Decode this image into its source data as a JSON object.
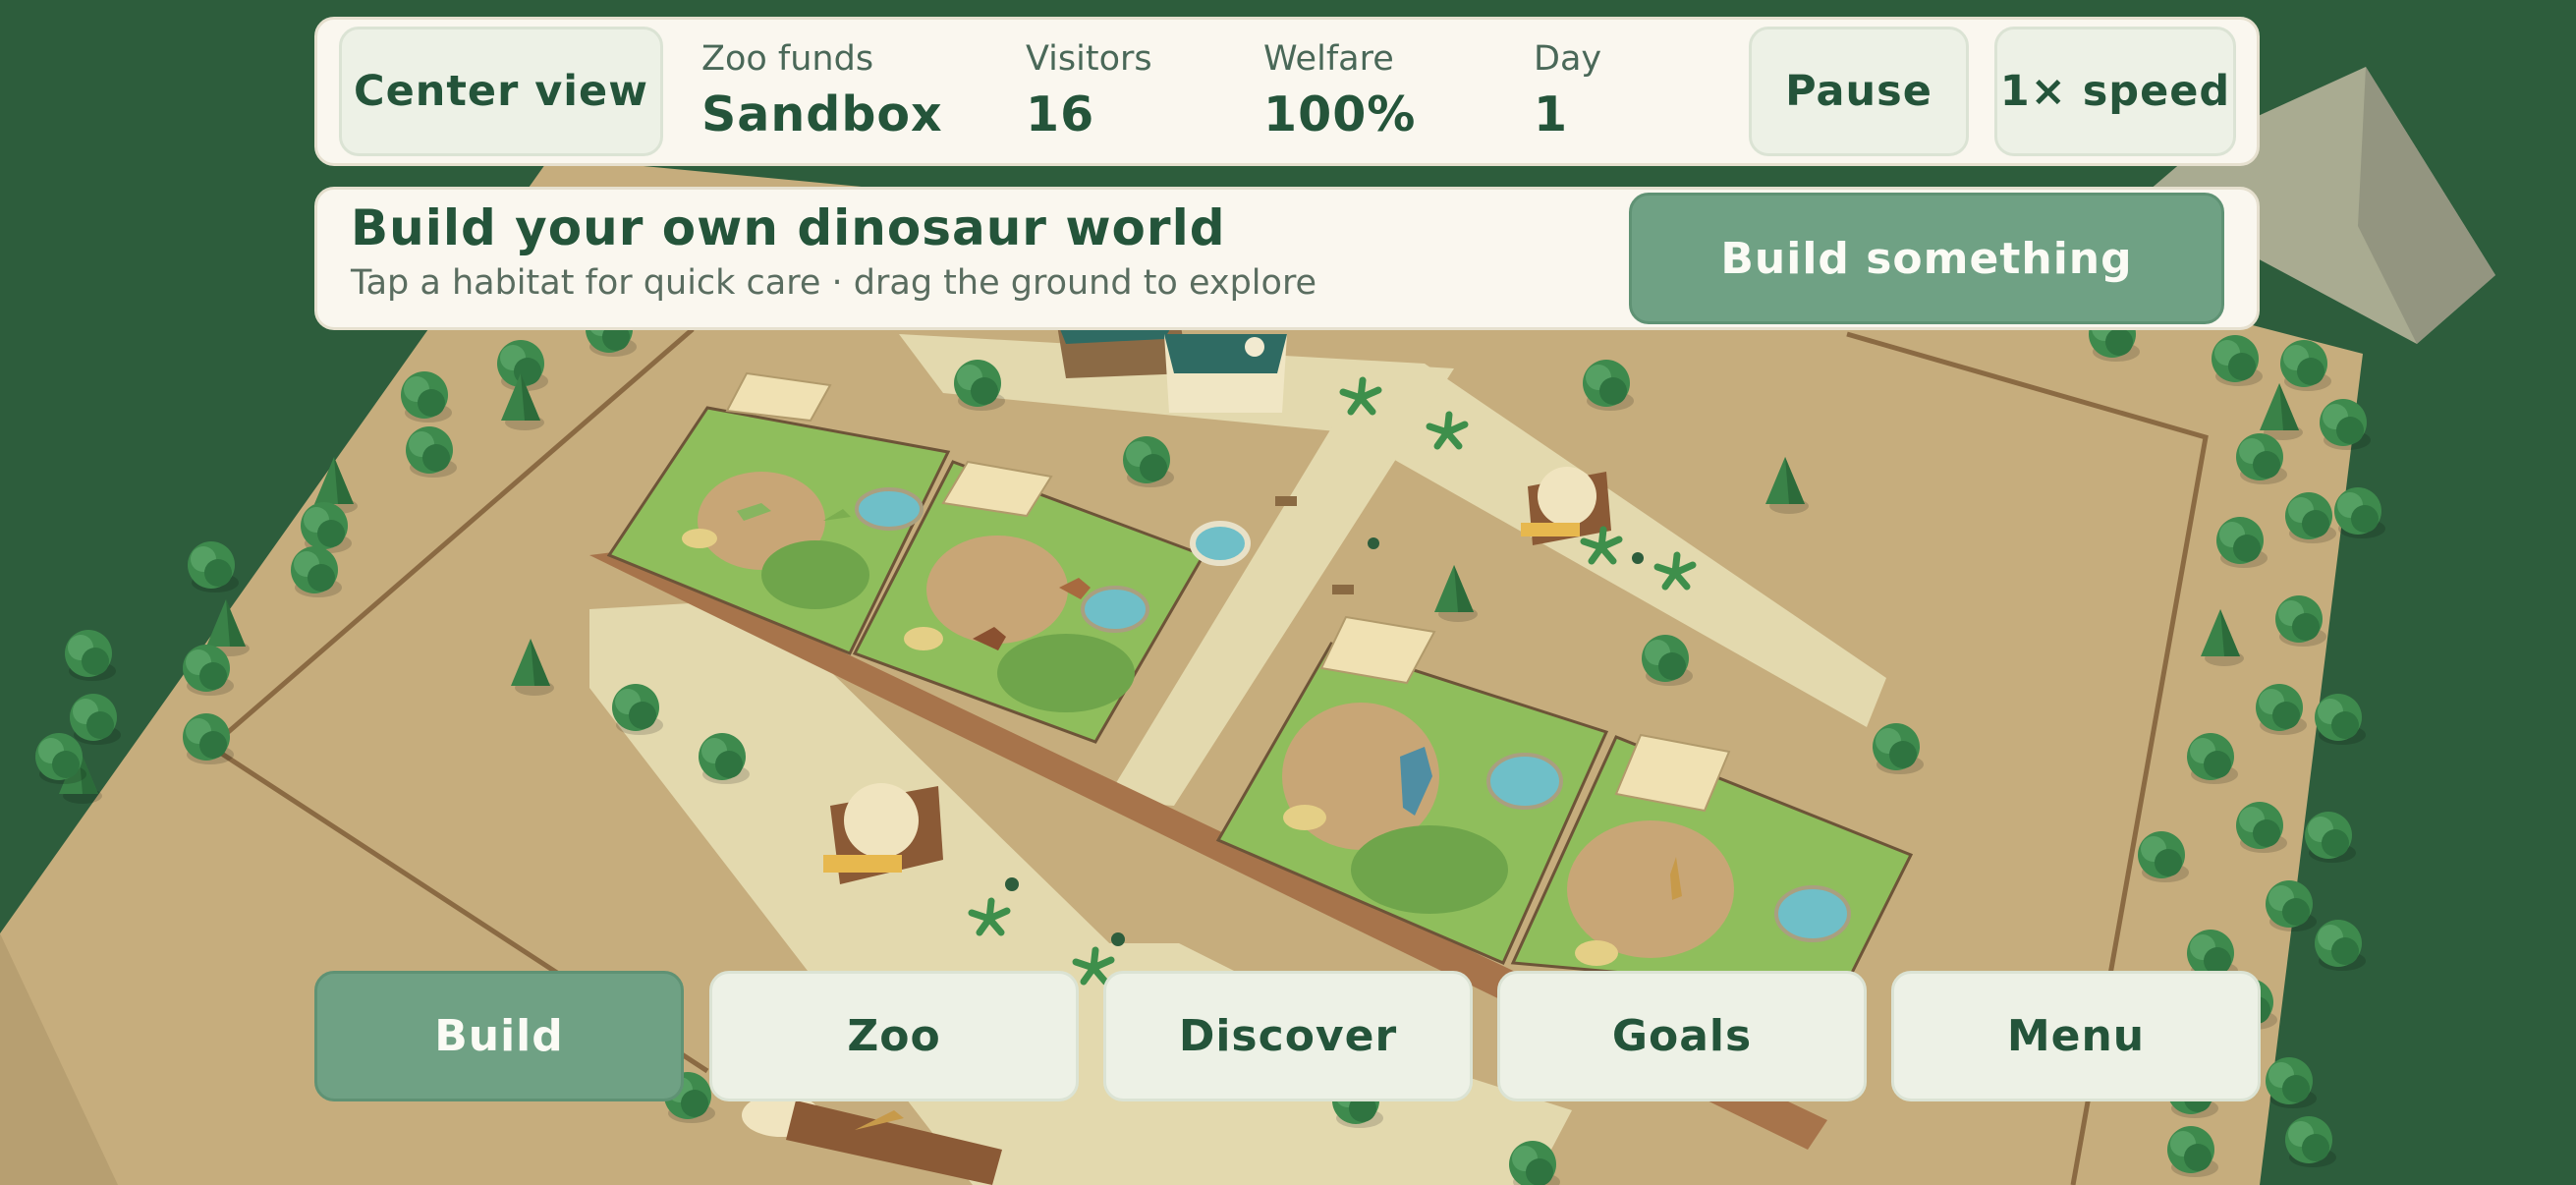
{
  "top_bar": {
    "center_view_label": "Center view",
    "stats": [
      {
        "label": "Zoo funds",
        "value": "Sandbox"
      },
      {
        "label": "Visitors",
        "value": "16"
      },
      {
        "label": "Welfare",
        "value": "100%"
      },
      {
        "label": "Day",
        "value": "1"
      }
    ],
    "pause_label": "Pause",
    "speed_label": "1× speed"
  },
  "banner": {
    "title": "Build your own dinosaur world",
    "subtitle": "Tap a habitat for quick care · drag the ground to explore",
    "action_label": "Build something"
  },
  "bottom_nav": [
    {
      "label": "Build",
      "active": true
    },
    {
      "label": "Zoo",
      "active": false
    },
    {
      "label": "Discover",
      "active": false
    },
    {
      "label": "Goals",
      "active": false
    },
    {
      "label": "Menu",
      "active": false
    }
  ],
  "colors": {
    "outer_grass": "#2d5d3c",
    "ground": "#c6ad7d",
    "path": "#e3d9ae",
    "habitat_grass": "#8fbe5c",
    "water": "#6fbfc8",
    "accent_green": "#6fa184",
    "dark_text": "#24543a",
    "panel": "#faf7ef"
  }
}
